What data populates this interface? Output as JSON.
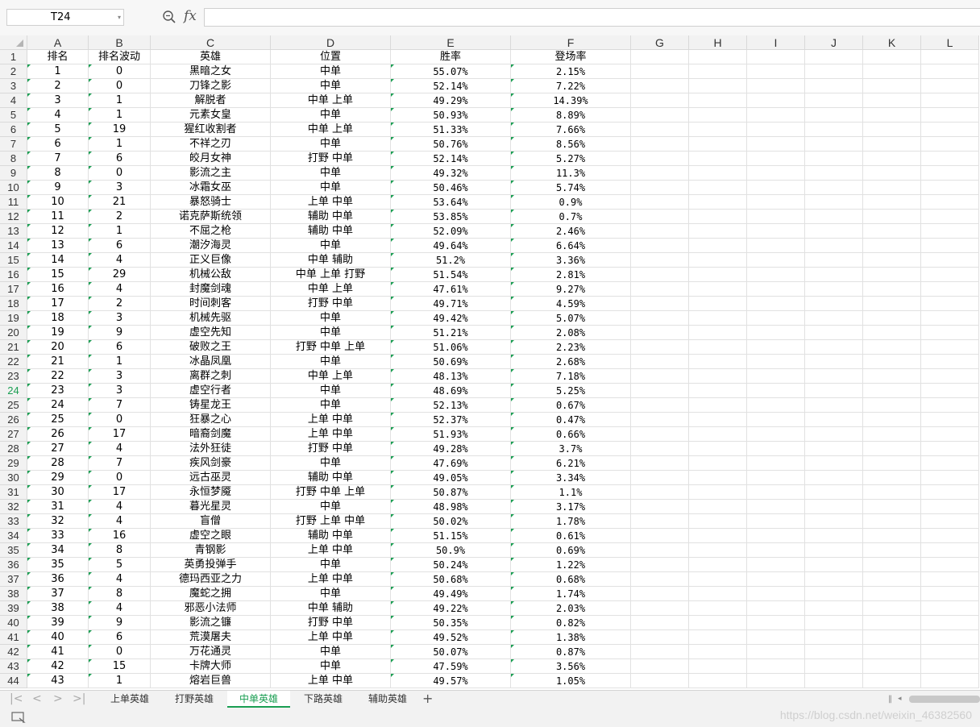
{
  "formula_bar": {
    "name_box": "T24",
    "fx_label": "fx",
    "formula": ""
  },
  "columns": [
    "A",
    "B",
    "C",
    "D",
    "E",
    "F",
    "G",
    "H",
    "I",
    "J",
    "K",
    "L"
  ],
  "selected_row": "24",
  "rows": [
    {
      "n": "1",
      "a": "排名",
      "b": "排名波动",
      "c": "英雄",
      "d": "位置",
      "e": "胜率",
      "f": "登场率"
    },
    {
      "n": "2",
      "a": "1",
      "b": "0",
      "c": "黑暗之女",
      "d": "中单",
      "e": "55.07%",
      "f": "2.15%"
    },
    {
      "n": "3",
      "a": "2",
      "b": "0",
      "c": "刀锋之影",
      "d": "中单",
      "e": "52.14%",
      "f": "7.22%"
    },
    {
      "n": "4",
      "a": "3",
      "b": "1",
      "c": "解脱者",
      "d": "中单 上单",
      "e": "49.29%",
      "f": "14.39%"
    },
    {
      "n": "5",
      "a": "4",
      "b": "1",
      "c": "元素女皇",
      "d": "中单",
      "e": "50.93%",
      "f": "8.89%"
    },
    {
      "n": "6",
      "a": "5",
      "b": "19",
      "c": "猩红收割者",
      "d": "中单 上单",
      "e": "51.33%",
      "f": "7.66%"
    },
    {
      "n": "7",
      "a": "6",
      "b": "1",
      "c": "不祥之刃",
      "d": "中单",
      "e": "50.76%",
      "f": "8.56%"
    },
    {
      "n": "8",
      "a": "7",
      "b": "6",
      "c": "皎月女神",
      "d": "打野 中单",
      "e": "52.14%",
      "f": "5.27%"
    },
    {
      "n": "9",
      "a": "8",
      "b": "0",
      "c": "影流之主",
      "d": "中单",
      "e": "49.32%",
      "f": "11.3%"
    },
    {
      "n": "10",
      "a": "9",
      "b": "3",
      "c": "冰霜女巫",
      "d": "中单",
      "e": "50.46%",
      "f": "5.74%"
    },
    {
      "n": "11",
      "a": "10",
      "b": "21",
      "c": "暴怒骑士",
      "d": "上单 中单",
      "e": "53.64%",
      "f": "0.9%"
    },
    {
      "n": "12",
      "a": "11",
      "b": "2",
      "c": "诺克萨斯统领",
      "d": "辅助 中单",
      "e": "53.85%",
      "f": "0.7%"
    },
    {
      "n": "13",
      "a": "12",
      "b": "1",
      "c": "不屈之枪",
      "d": "辅助 中单",
      "e": "52.09%",
      "f": "2.46%"
    },
    {
      "n": "14",
      "a": "13",
      "b": "6",
      "c": "潮汐海灵",
      "d": "中单",
      "e": "49.64%",
      "f": "6.64%"
    },
    {
      "n": "15",
      "a": "14",
      "b": "4",
      "c": "正义巨像",
      "d": "中单 辅助",
      "e": "51.2%",
      "f": "3.36%"
    },
    {
      "n": "16",
      "a": "15",
      "b": "29",
      "c": "机械公敌",
      "d": "中单 上单 打野",
      "e": "51.54%",
      "f": "2.81%"
    },
    {
      "n": "17",
      "a": "16",
      "b": "4",
      "c": "封魔剑魂",
      "d": "中单 上单",
      "e": "47.61%",
      "f": "9.27%"
    },
    {
      "n": "18",
      "a": "17",
      "b": "2",
      "c": "时间刺客",
      "d": "打野 中单",
      "e": "49.71%",
      "f": "4.59%"
    },
    {
      "n": "19",
      "a": "18",
      "b": "3",
      "c": "机械先驱",
      "d": "中单",
      "e": "49.42%",
      "f": "5.07%"
    },
    {
      "n": "20",
      "a": "19",
      "b": "9",
      "c": "虚空先知",
      "d": "中单",
      "e": "51.21%",
      "f": "2.08%"
    },
    {
      "n": "21",
      "a": "20",
      "b": "6",
      "c": "破败之王",
      "d": "打野 中单 上单",
      "e": "51.06%",
      "f": "2.23%"
    },
    {
      "n": "22",
      "a": "21",
      "b": "1",
      "c": "冰晶凤凰",
      "d": "中单",
      "e": "50.69%",
      "f": "2.68%"
    },
    {
      "n": "23",
      "a": "22",
      "b": "3",
      "c": "离群之刺",
      "d": "中单 上单",
      "e": "48.13%",
      "f": "7.18%"
    },
    {
      "n": "24",
      "a": "23",
      "b": "3",
      "c": "虚空行者",
      "d": "中单",
      "e": "48.69%",
      "f": "5.25%"
    },
    {
      "n": "25",
      "a": "24",
      "b": "7",
      "c": "铸星龙王",
      "d": "中单",
      "e": "52.13%",
      "f": "0.67%"
    },
    {
      "n": "26",
      "a": "25",
      "b": "0",
      "c": "狂暴之心",
      "d": "上单 中单",
      "e": "52.37%",
      "f": "0.47%"
    },
    {
      "n": "27",
      "a": "26",
      "b": "17",
      "c": "暗裔剑魔",
      "d": "上单 中单",
      "e": "51.93%",
      "f": "0.66%"
    },
    {
      "n": "28",
      "a": "27",
      "b": "4",
      "c": "法外狂徒",
      "d": "打野 中单",
      "e": "49.28%",
      "f": "3.7%"
    },
    {
      "n": "29",
      "a": "28",
      "b": "7",
      "c": "疾风剑豪",
      "d": "中单",
      "e": "47.69%",
      "f": "6.21%"
    },
    {
      "n": "30",
      "a": "29",
      "b": "0",
      "c": "远古巫灵",
      "d": "辅助 中单",
      "e": "49.05%",
      "f": "3.34%"
    },
    {
      "n": "31",
      "a": "30",
      "b": "17",
      "c": "永恒梦魇",
      "d": "打野 中单 上单",
      "e": "50.87%",
      "f": "1.1%"
    },
    {
      "n": "32",
      "a": "31",
      "b": "4",
      "c": "暮光星灵",
      "d": "中单",
      "e": "48.98%",
      "f": "3.17%"
    },
    {
      "n": "33",
      "a": "32",
      "b": "4",
      "c": "盲僧",
      "d": "打野 上单 中单",
      "e": "50.02%",
      "f": "1.78%"
    },
    {
      "n": "34",
      "a": "33",
      "b": "16",
      "c": "虚空之眼",
      "d": "辅助 中单",
      "e": "51.15%",
      "f": "0.61%"
    },
    {
      "n": "35",
      "a": "34",
      "b": "8",
      "c": "青钢影",
      "d": "上单 中单",
      "e": "50.9%",
      "f": "0.69%"
    },
    {
      "n": "36",
      "a": "35",
      "b": "5",
      "c": "英勇投弹手",
      "d": "中单",
      "e": "50.24%",
      "f": "1.22%"
    },
    {
      "n": "37",
      "a": "36",
      "b": "4",
      "c": "德玛西亚之力",
      "d": "上单 中单",
      "e": "50.68%",
      "f": "0.68%"
    },
    {
      "n": "38",
      "a": "37",
      "b": "8",
      "c": "魔蛇之拥",
      "d": "中单",
      "e": "49.49%",
      "f": "1.74%"
    },
    {
      "n": "39",
      "a": "38",
      "b": "4",
      "c": "邪恶小法师",
      "d": "中单 辅助",
      "e": "49.22%",
      "f": "2.03%"
    },
    {
      "n": "40",
      "a": "39",
      "b": "9",
      "c": "影流之镰",
      "d": "打野 中单",
      "e": "50.35%",
      "f": "0.82%"
    },
    {
      "n": "41",
      "a": "40",
      "b": "6",
      "c": "荒漠屠夫",
      "d": "上单 中单",
      "e": "49.52%",
      "f": "1.38%"
    },
    {
      "n": "42",
      "a": "41",
      "b": "0",
      "c": "万花通灵",
      "d": "中单",
      "e": "50.07%",
      "f": "0.87%"
    },
    {
      "n": "43",
      "a": "42",
      "b": "15",
      "c": "卡牌大师",
      "d": "中单",
      "e": "47.59%",
      "f": "3.56%"
    },
    {
      "n": "44",
      "a": "43",
      "b": "1",
      "c": "熔岩巨兽",
      "d": "上单 中单",
      "e": "49.57%",
      "f": "1.05%"
    }
  ],
  "sheet_tabs": [
    {
      "label": "上单英雄",
      "active": false
    },
    {
      "label": "打野英雄",
      "active": false
    },
    {
      "label": "中单英雄",
      "active": true
    },
    {
      "label": "下路英雄",
      "active": false
    },
    {
      "label": "辅助英雄",
      "active": false
    }
  ],
  "add_sheet_label": "+",
  "watermark": "https://blog.csdn.net/weixin_46382560",
  "colors": {
    "accent": "#1a9e52",
    "header_bg": "#f2f2f2",
    "grid_line": "#e1e1e1"
  }
}
